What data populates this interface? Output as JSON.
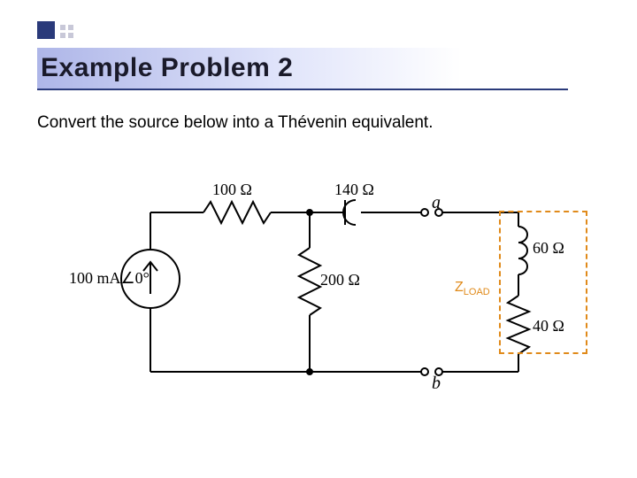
{
  "accent": {
    "square_color": "#2a3a7a"
  },
  "title": "Example Problem 2",
  "body": "Convert the source below into a Thévenin equivalent.",
  "circuit": {
    "source": {
      "value": "100 mA",
      "angle": "0°",
      "label": "100 mA∠0°"
    },
    "r_top_left": "100 Ω",
    "c_top_right": "140 Ω",
    "r_mid": "200 Ω",
    "node_a": "a",
    "node_b": "b",
    "l_load": "60 Ω",
    "r_load": "40 Ω",
    "zload_label_main": "Z",
    "zload_label_sub": "LOAD"
  }
}
